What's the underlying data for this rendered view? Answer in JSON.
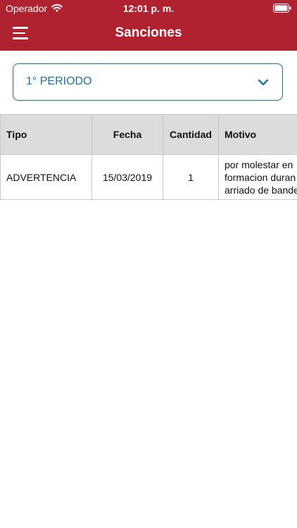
{
  "status": {
    "carrier": "Operador",
    "time": "12:01 p. m."
  },
  "nav": {
    "title": "Sanciones"
  },
  "period": {
    "selected": "1° PERIODO"
  },
  "table": {
    "headers": {
      "tipo": "Tipo",
      "fecha": "Fecha",
      "cantidad": "Cantidad",
      "motivo": "Motivo"
    },
    "rows": [
      {
        "tipo": "ADVERTENCIA",
        "fecha": "15/03/2019",
        "cantidad": "1",
        "motivo_lines": [
          "por molestar en",
          "formacion duran",
          "arriado de bande"
        ]
      }
    ]
  },
  "colors": {
    "brand": "#b02230",
    "accent": "#1a6fa8",
    "header_bg": "#dcdcdc"
  },
  "icons": [
    "wifi-icon",
    "battery-icon",
    "hamburger-menu-icon",
    "chevron-down-icon"
  ]
}
